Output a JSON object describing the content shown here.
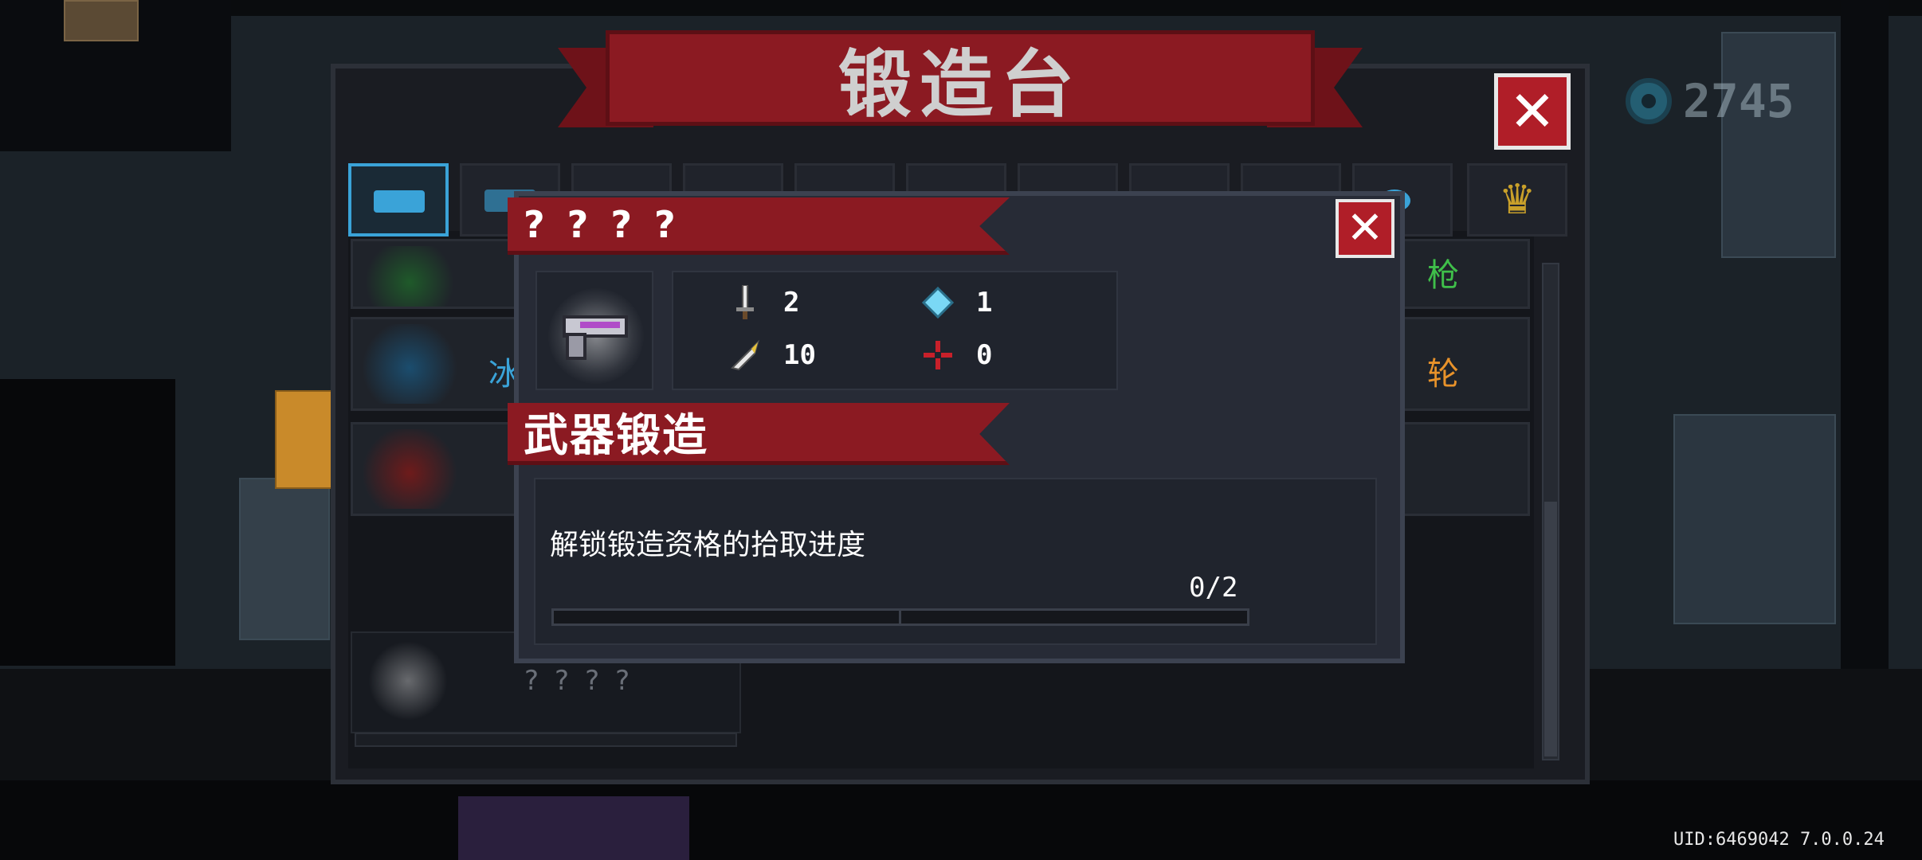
{
  "window": {
    "title": "锻造台",
    "close_label": "✕"
  },
  "currency": {
    "icon": "gem-icon",
    "value": "2745"
  },
  "tabs": [
    {
      "icon": "pistol-icon",
      "active": true
    },
    {
      "icon": "rifle-icon"
    },
    {
      "icon": "shotgun-icon"
    },
    {
      "icon": "laser-icon"
    },
    {
      "icon": "blade-icon"
    },
    {
      "icon": "spear-icon"
    },
    {
      "icon": "bow-icon"
    },
    {
      "icon": "staff-icon"
    },
    {
      "icon": "launcher-icon"
    },
    {
      "icon": "fish-icon"
    },
    {
      "icon": "crown-icon",
      "glyph": "♛"
    }
  ],
  "list": {
    "rows": [
      {
        "left_text": "冰",
        "right_text": "轮"
      },
      {
        "left_text": "",
        "right_text": ""
      }
    ],
    "partial_top_right_text": "枪",
    "bottom_item_name": "????"
  },
  "popup": {
    "title": "????",
    "close_label": "✕",
    "stats": {
      "attack": {
        "icon": "sword-icon",
        "value": "2"
      },
      "energy": {
        "icon": "crystal-icon",
        "value": "1"
      },
      "crit": {
        "icon": "bullet-icon",
        "value": "10"
      },
      "accuracy": {
        "icon": "crosshair-icon",
        "value": "0"
      }
    },
    "section_title": "武器锻造",
    "progress": {
      "label": "解锁锻造资格的拾取进度",
      "count": "0/2",
      "fraction": 0
    }
  },
  "footer": {
    "uid": "UID:6469042 7.0.0.24"
  },
  "colors": {
    "banner_red": "#8b1a22",
    "accent_blue": "#3aa3d8",
    "panel_dark": "#272b36"
  }
}
